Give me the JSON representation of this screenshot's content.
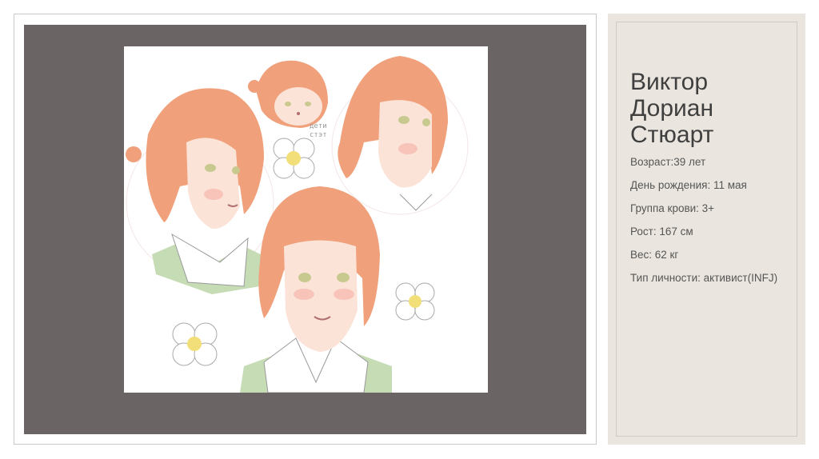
{
  "character": {
    "name_lines": [
      "Виктор",
      "Дориан",
      "Стюарт"
    ],
    "facts": [
      "Возраст:39 лет",
      "День рождения: 11 мая",
      "Группа крови: 3+",
      "Рост: 167 см",
      "Вес: 62 кг",
      "Тип личности: активист(INFJ)"
    ]
  },
  "artwork": {
    "sketch_note": "дети\nстэт"
  },
  "colors": {
    "panel_dark": "#6b6464",
    "info_bg": "#eae6df",
    "hair": "#f0a07a",
    "skin": "#fbe3d8",
    "collar_green": "#c6dcb4",
    "flower_center": "#f3df7a"
  }
}
